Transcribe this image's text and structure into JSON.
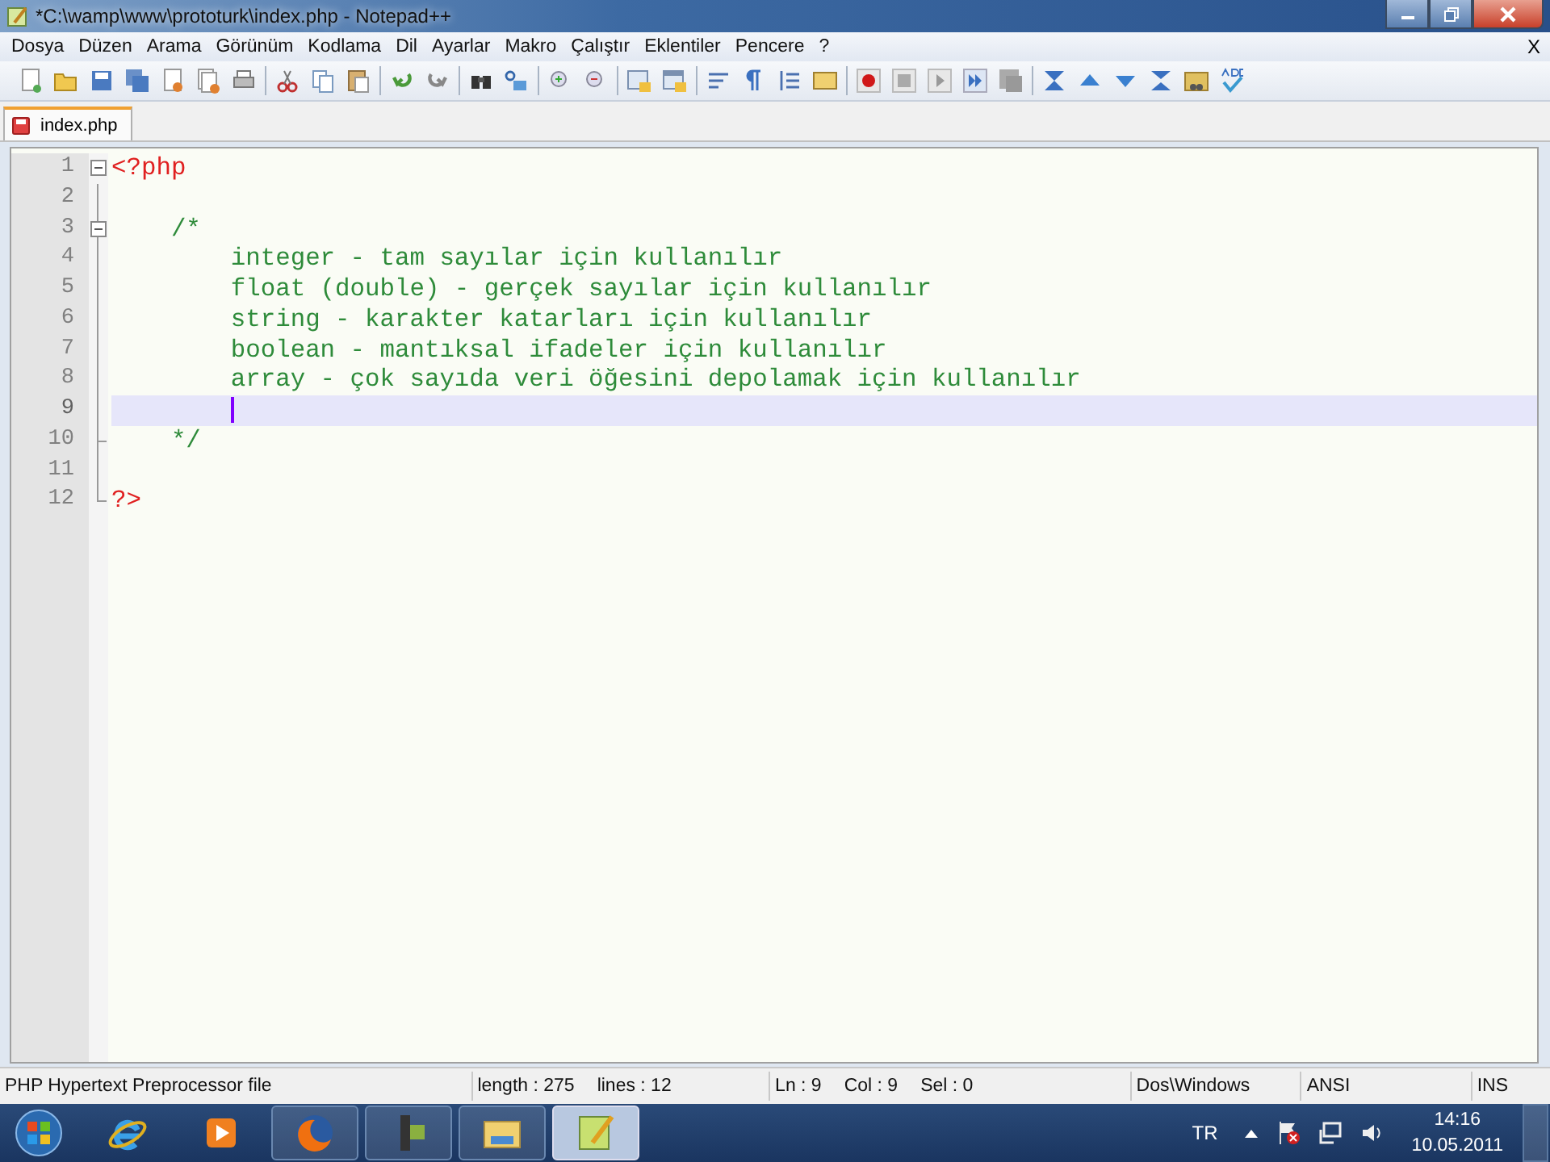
{
  "window": {
    "title": "*C:\\wamp\\www\\prototurk\\index.php - Notepad++"
  },
  "menu": {
    "items": [
      "Dosya",
      "Düzen",
      "Arama",
      "Görünüm",
      "Kodlama",
      "Dil",
      "Ayarlar",
      "Makro",
      "Çalıştır",
      "Eklentiler",
      "Pencere",
      "?"
    ],
    "close": "X"
  },
  "tabs": [
    {
      "label": "index.php",
      "selected": true,
      "modified": true
    }
  ],
  "editor": {
    "lines": [
      {
        "number": "1",
        "kind": "tag",
        "text": "<?php",
        "fold_start": true,
        "fold_end": false,
        "current": false
      },
      {
        "number": "2",
        "fold_start": false,
        "fold_end": false,
        "current": false
      },
      {
        "number": "3",
        "kind": "comment",
        "text": "    /*",
        "fold_start": true,
        "fold_end": false,
        "current": false
      },
      {
        "number": "4",
        "kind": "comment",
        "text": "        integer - tam sayılar için kullanılır",
        "fold_start": false,
        "fold_end": false,
        "current": false
      },
      {
        "number": "5",
        "kind": "comment",
        "text": "        float (double) - gerçek sayılar için kullanılır",
        "fold_start": false,
        "fold_end": false,
        "current": false
      },
      {
        "number": "6",
        "kind": "comment",
        "text": "        string - karakter katarları için kullanılır",
        "fold_start": false,
        "fold_end": false,
        "current": false
      },
      {
        "number": "7",
        "kind": "comment",
        "text": "        boolean - mantıksal ifadeler için kullanılır",
        "fold_start": false,
        "fold_end": false,
        "current": false
      },
      {
        "number": "8",
        "kind": "comment",
        "text": "        array - çok sayıda veri öğesini depolamak için kullanılır",
        "fold_start": false,
        "fold_end": false,
        "current": false
      },
      {
        "number": "9",
        "fold_start": false,
        "fold_end": false,
        "current": true
      },
      {
        "number": "10",
        "kind": "comment",
        "text": "    */",
        "fold_start": false,
        "fold_end": true,
        "current": false
      },
      {
        "number": "11",
        "fold_start": false,
        "fold_end": false,
        "current": false
      },
      {
        "number": "12",
        "kind": "tag",
        "text": "?>",
        "fold_start": false,
        "fold_end": true,
        "current": false
      }
    ]
  },
  "status_bar": {
    "file_type": "PHP Hypertext Preprocessor file",
    "length": "length : 275",
    "lines": "lines : 12",
    "line": "Ln : 9",
    "column": "Col : 9",
    "selection": "Sel : 0",
    "line_endings": "Dos\\Windows",
    "encoding": "ANSI",
    "mode": "INS"
  },
  "taskbar": {
    "apps": [
      {
        "kind": "browser-e",
        "selected": false
      },
      {
        "kind": "media",
        "selected": false
      },
      {
        "kind": "firefox",
        "selected": false
      },
      {
        "kind": "camera",
        "selected": false
      },
      {
        "kind": "folder",
        "selected": false
      },
      {
        "kind": "notepad",
        "selected": true
      }
    ],
    "language": "TR",
    "time": "14:16",
    "date": "10.05.2011"
  }
}
